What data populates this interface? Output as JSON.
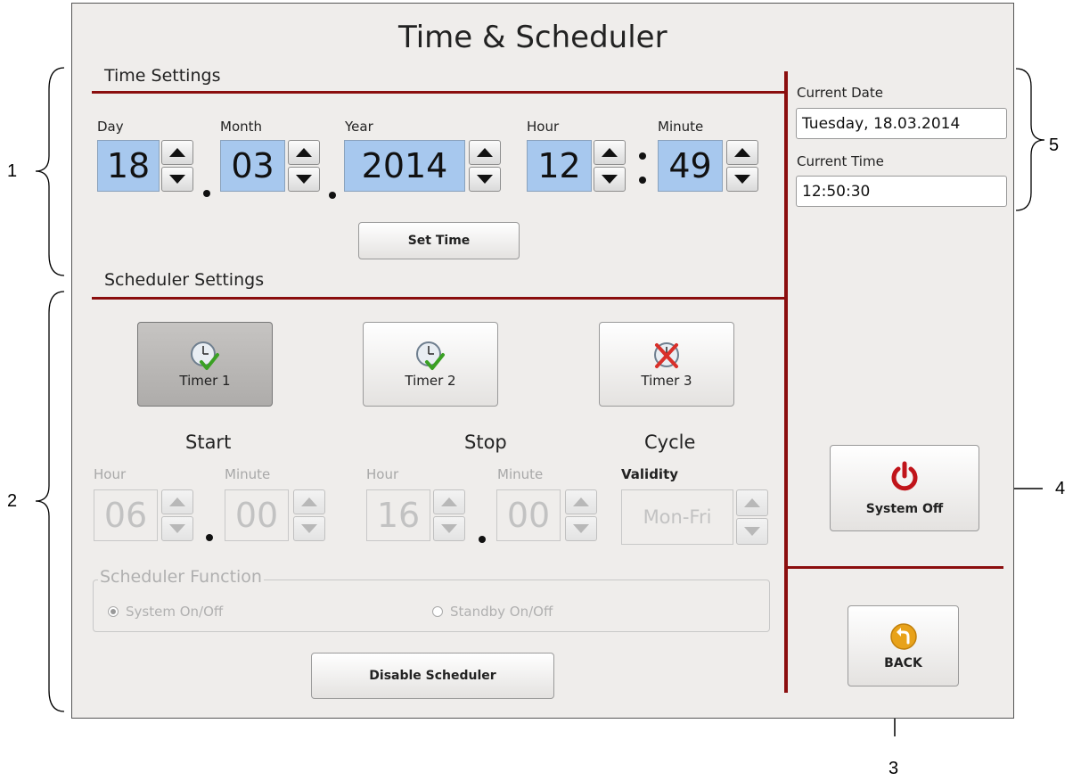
{
  "window": {
    "title": "Time & Scheduler"
  },
  "time_settings": {
    "section_title": "Time Settings",
    "day": {
      "label": "Day",
      "value": "18"
    },
    "month": {
      "label": "Month",
      "value": "03"
    },
    "year": {
      "label": "Year",
      "value": "2014"
    },
    "hour": {
      "label": "Hour",
      "value": "12"
    },
    "minute": {
      "label": "Minute",
      "value": "49"
    },
    "set_time_label": "Set Time"
  },
  "scheduler_settings": {
    "section_title": "Scheduler Settings",
    "timers": [
      {
        "label": "Timer 1",
        "icon": "clock-check-icon",
        "state": "selected"
      },
      {
        "label": "Timer 2",
        "icon": "clock-check-icon",
        "state": "enabled"
      },
      {
        "label": "Timer 3",
        "icon": "clock-cross-icon",
        "state": "disabled"
      }
    ],
    "start": {
      "heading": "Start",
      "hour_label": "Hour",
      "hour_value": "06",
      "minute_label": "Minute",
      "minute_value": "00"
    },
    "stop": {
      "heading": "Stop",
      "hour_label": "Hour",
      "hour_value": "16",
      "minute_label": "Minute",
      "minute_value": "00"
    },
    "cycle": {
      "heading": "Cycle",
      "validity_label": "Validity",
      "validity_value": "Mon-Fri"
    },
    "function_group": {
      "legend": "Scheduler Function",
      "options": [
        {
          "label": "System On/Off",
          "selected": true
        },
        {
          "label": "Standby On/Off",
          "selected": false
        }
      ]
    },
    "disable_label": "Disable Scheduler"
  },
  "status": {
    "current_date_label": "Current Date",
    "current_date_value": "Tuesday, 18.03.2014",
    "current_time_label": "Current Time",
    "current_time_value": "12:50:30"
  },
  "actions": {
    "system_off_label": "System Off",
    "back_label": "BACK"
  },
  "callouts": [
    "1",
    "2",
    "3",
    "4",
    "5"
  ],
  "colors": {
    "accent_line": "#8b0e0e",
    "value_box": "#a7c8ee",
    "panel_background": "#efedeb",
    "power_icon": "#c0141a",
    "check_mark": "#3aa023",
    "cross_mark": "#d9302a",
    "back_icon": "#e8a21a"
  }
}
